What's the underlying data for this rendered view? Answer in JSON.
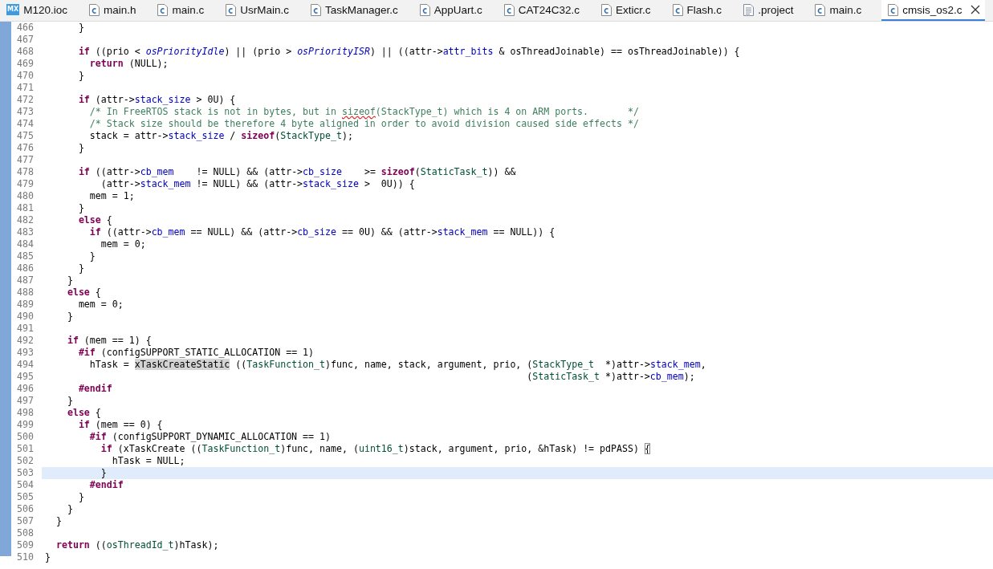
{
  "tabs": [
    {
      "label": "M120.ioc",
      "kind": "mx",
      "badge": "MX",
      "selected": false
    },
    {
      "label": "main.h",
      "kind": "c",
      "selected": false
    },
    {
      "label": "main.c",
      "kind": "c",
      "selected": false
    },
    {
      "label": "UsrMain.c",
      "kind": "c",
      "selected": false
    },
    {
      "label": "TaskManager.c",
      "kind": "c",
      "selected": false
    },
    {
      "label": "AppUart.c",
      "kind": "c",
      "selected": false
    },
    {
      "label": "CAT24C32.c",
      "kind": "c",
      "selected": false
    },
    {
      "label": "Exticr.c",
      "kind": "c",
      "selected": false
    },
    {
      "label": "Flash.c",
      "kind": "c",
      "selected": false
    },
    {
      "label": ".project",
      "kind": "text",
      "selected": false
    },
    {
      "label": "main.c",
      "kind": "c",
      "selected": false
    },
    {
      "label": "cmsis_os2.c",
      "kind": "c",
      "selected": true
    }
  ],
  "editor": {
    "lines": [
      {
        "number": "466",
        "current": false,
        "tokens": [
          {
            "kind": "plain",
            "text": "      }"
          }
        ]
      },
      {
        "number": "467",
        "current": false
      },
      {
        "number": "468",
        "current": false,
        "tokens": [
          {
            "kind": "keyword",
            "text": "      if"
          },
          {
            "kind": "plain",
            "text": " ((prio < "
          },
          {
            "kind": "constant",
            "text": "osPriorityIdle"
          },
          {
            "kind": "plain",
            "text": ") || (prio > "
          },
          {
            "kind": "constant",
            "text": "osPriorityISR"
          },
          {
            "kind": "plain",
            "text": ") || ((attr->"
          },
          {
            "kind": "field",
            "text": "attr_bits"
          },
          {
            "kind": "plain",
            "text": " & osThreadJoinable) == osThreadJoinable)) {"
          }
        ]
      },
      {
        "number": "469",
        "current": false,
        "tokens": [
          {
            "kind": "keyword",
            "text": "        return"
          },
          {
            "kind": "plain",
            "text": " (NULL);"
          }
        ]
      },
      {
        "number": "470",
        "current": false,
        "tokens": [
          {
            "kind": "plain",
            "text": "      }"
          }
        ]
      },
      {
        "number": "471",
        "current": false
      },
      {
        "number": "472",
        "current": false,
        "tokens": [
          {
            "kind": "keyword",
            "text": "      if"
          },
          {
            "kind": "plain",
            "text": " (attr->"
          },
          {
            "kind": "field",
            "text": "stack_size"
          },
          {
            "kind": "plain",
            "text": " > 0U) {"
          }
        ]
      },
      {
        "number": "473",
        "current": false,
        "tokens": [
          {
            "kind": "comment",
            "text": "        /* In FreeRTOS stack is not in bytes, but in "
          },
          {
            "kind": "misspelled",
            "text": "sizeof"
          },
          {
            "kind": "comment",
            "text": "(StackType_t) which is 4 on ARM ports.       */"
          }
        ]
      },
      {
        "number": "474",
        "current": false,
        "tokens": [
          {
            "kind": "comment",
            "text": "        /* Stack size should be therefore 4 byte aligned in order to avoid division caused side effects */"
          }
        ]
      },
      {
        "number": "475",
        "current": false,
        "tokens": [
          {
            "kind": "plain",
            "text": "        stack = attr->"
          },
          {
            "kind": "field",
            "text": "stack_size"
          },
          {
            "kind": "plain",
            "text": " / "
          },
          {
            "kind": "keyword",
            "text": "sizeof"
          },
          {
            "kind": "plain",
            "text": "("
          },
          {
            "kind": "type",
            "text": "StackType_t"
          },
          {
            "kind": "plain",
            "text": ");"
          }
        ]
      },
      {
        "number": "476",
        "current": false,
        "tokens": [
          {
            "kind": "plain",
            "text": "      }"
          }
        ]
      },
      {
        "number": "477",
        "current": false
      },
      {
        "number": "478",
        "current": false,
        "tokens": [
          {
            "kind": "keyword",
            "text": "      if"
          },
          {
            "kind": "plain",
            "text": " ((attr->"
          },
          {
            "kind": "field",
            "text": "cb_mem"
          },
          {
            "kind": "plain",
            "text": "    != NULL) && (attr->"
          },
          {
            "kind": "field",
            "text": "cb_size"
          },
          {
            "kind": "plain",
            "text": "    >= "
          },
          {
            "kind": "keyword",
            "text": "sizeof"
          },
          {
            "kind": "plain",
            "text": "("
          },
          {
            "kind": "type",
            "text": "StaticTask_t"
          },
          {
            "kind": "plain",
            "text": ")) &&"
          }
        ]
      },
      {
        "number": "479",
        "current": false,
        "tokens": [
          {
            "kind": "plain",
            "text": "          (attr->"
          },
          {
            "kind": "field",
            "text": "stack_mem"
          },
          {
            "kind": "plain",
            "text": " != NULL) && (attr->"
          },
          {
            "kind": "field",
            "text": "stack_size"
          },
          {
            "kind": "plain",
            "text": " >  0U)) {"
          }
        ]
      },
      {
        "number": "480",
        "current": false,
        "tokens": [
          {
            "kind": "plain",
            "text": "        mem = 1;"
          }
        ]
      },
      {
        "number": "481",
        "current": false,
        "tokens": [
          {
            "kind": "plain",
            "text": "      }"
          }
        ]
      },
      {
        "number": "482",
        "current": false,
        "tokens": [
          {
            "kind": "keyword",
            "text": "      else"
          },
          {
            "kind": "plain",
            "text": " {"
          }
        ]
      },
      {
        "number": "483",
        "current": false,
        "tokens": [
          {
            "kind": "keyword",
            "text": "        if"
          },
          {
            "kind": "plain",
            "text": " ((attr->"
          },
          {
            "kind": "field",
            "text": "cb_mem"
          },
          {
            "kind": "plain",
            "text": " == NULL) && (attr->"
          },
          {
            "kind": "field",
            "text": "cb_size"
          },
          {
            "kind": "plain",
            "text": " == 0U) && (attr->"
          },
          {
            "kind": "field",
            "text": "stack_mem"
          },
          {
            "kind": "plain",
            "text": " == NULL)) {"
          }
        ]
      },
      {
        "number": "484",
        "current": false,
        "tokens": [
          {
            "kind": "plain",
            "text": "          mem = 0;"
          }
        ]
      },
      {
        "number": "485",
        "current": false,
        "tokens": [
          {
            "kind": "plain",
            "text": "        }"
          }
        ]
      },
      {
        "number": "486",
        "current": false,
        "tokens": [
          {
            "kind": "plain",
            "text": "      }"
          }
        ]
      },
      {
        "number": "487",
        "current": false,
        "tokens": [
          {
            "kind": "plain",
            "text": "    }"
          }
        ]
      },
      {
        "number": "488",
        "current": false,
        "tokens": [
          {
            "kind": "keyword",
            "text": "    else"
          },
          {
            "kind": "plain",
            "text": " {"
          }
        ]
      },
      {
        "number": "489",
        "current": false,
        "tokens": [
          {
            "kind": "plain",
            "text": "      mem = 0;"
          }
        ]
      },
      {
        "number": "490",
        "current": false,
        "tokens": [
          {
            "kind": "plain",
            "text": "    }"
          }
        ]
      },
      {
        "number": "491",
        "current": false
      },
      {
        "number": "492",
        "current": false,
        "tokens": [
          {
            "kind": "keyword",
            "text": "    if"
          },
          {
            "kind": "plain",
            "text": " (mem == 1) {"
          }
        ]
      },
      {
        "number": "493",
        "current": false,
        "tokens": [
          {
            "kind": "keyword",
            "text": "      #if"
          },
          {
            "kind": "plain",
            "text": " (configSUPPORT_STATIC_ALLOCATION == 1)"
          }
        ]
      },
      {
        "number": "494",
        "current": false,
        "tokens": [
          {
            "kind": "plain",
            "text": "        hTask = "
          },
          {
            "kind": "occurrence",
            "text": "xTaskCreateStatic"
          },
          {
            "kind": "plain",
            "text": " (("
          },
          {
            "kind": "type",
            "text": "TaskFunction_t"
          },
          {
            "kind": "plain",
            "text": ")func, name, stack, argument, prio, ("
          },
          {
            "kind": "type",
            "text": "StackType_t"
          },
          {
            "kind": "plain",
            "text": "  *)attr->"
          },
          {
            "kind": "field",
            "text": "stack_mem"
          },
          {
            "kind": "plain",
            "text": ","
          }
        ]
      },
      {
        "number": "495",
        "current": false,
        "tokens": [
          {
            "kind": "plain",
            "text": "                                                                                      ("
          },
          {
            "kind": "type",
            "text": "StaticTask_t"
          },
          {
            "kind": "plain",
            "text": " *)attr->"
          },
          {
            "kind": "field",
            "text": "cb_mem"
          },
          {
            "kind": "plain",
            "text": ");"
          }
        ]
      },
      {
        "number": "496",
        "current": false,
        "tokens": [
          {
            "kind": "keyword",
            "text": "      #endif"
          }
        ]
      },
      {
        "number": "497",
        "current": false,
        "tokens": [
          {
            "kind": "plain",
            "text": "    }"
          }
        ]
      },
      {
        "number": "498",
        "current": false,
        "tokens": [
          {
            "kind": "keyword",
            "text": "    else"
          },
          {
            "kind": "plain",
            "text": " {"
          }
        ]
      },
      {
        "number": "499",
        "current": false,
        "tokens": [
          {
            "kind": "keyword",
            "text": "      if"
          },
          {
            "kind": "plain",
            "text": " (mem == 0) {"
          }
        ]
      },
      {
        "number": "500",
        "current": false,
        "tokens": [
          {
            "kind": "keyword",
            "text": "        #if"
          },
          {
            "kind": "plain",
            "text": " (configSUPPORT_DYNAMIC_ALLOCATION == 1)"
          }
        ]
      },
      {
        "number": "501",
        "current": false,
        "tokens": [
          {
            "kind": "keyword",
            "text": "          if"
          },
          {
            "kind": "plain",
            "text": " (xTaskCreate (("
          },
          {
            "kind": "type",
            "text": "TaskFunction_t"
          },
          {
            "kind": "plain",
            "text": ")func, name, ("
          },
          {
            "kind": "type",
            "text": "uint16_t"
          },
          {
            "kind": "plain",
            "text": ")stack, argument, prio, &hTask) != pdPASS) "
          },
          {
            "kind": "bracket",
            "text": "{"
          }
        ]
      },
      {
        "number": "502",
        "current": false,
        "tokens": [
          {
            "kind": "plain",
            "text": "            hTask = NULL;"
          }
        ]
      },
      {
        "number": "503",
        "current": true,
        "tokens": [
          {
            "kind": "plain",
            "text": "          }"
          }
        ]
      },
      {
        "number": "504",
        "current": false,
        "tokens": [
          {
            "kind": "keyword",
            "text": "        #endif"
          }
        ]
      },
      {
        "number": "505",
        "current": false,
        "tokens": [
          {
            "kind": "plain",
            "text": "      }"
          }
        ]
      },
      {
        "number": "506",
        "current": false,
        "tokens": [
          {
            "kind": "plain",
            "text": "    }"
          }
        ]
      },
      {
        "number": "507",
        "current": false,
        "tokens": [
          {
            "kind": "plain",
            "text": "  }"
          }
        ]
      },
      {
        "number": "508",
        "current": false
      },
      {
        "number": "509",
        "current": false,
        "tokens": [
          {
            "kind": "keyword",
            "text": "  return"
          },
          {
            "kind": "plain",
            "text": " (("
          },
          {
            "kind": "type",
            "text": "osThreadId_t"
          },
          {
            "kind": "plain",
            "text": ")hTask);"
          }
        ]
      },
      {
        "number": "510",
        "current": false,
        "tokens": [
          {
            "kind": "plain",
            "text": "}"
          }
        ]
      }
    ]
  }
}
